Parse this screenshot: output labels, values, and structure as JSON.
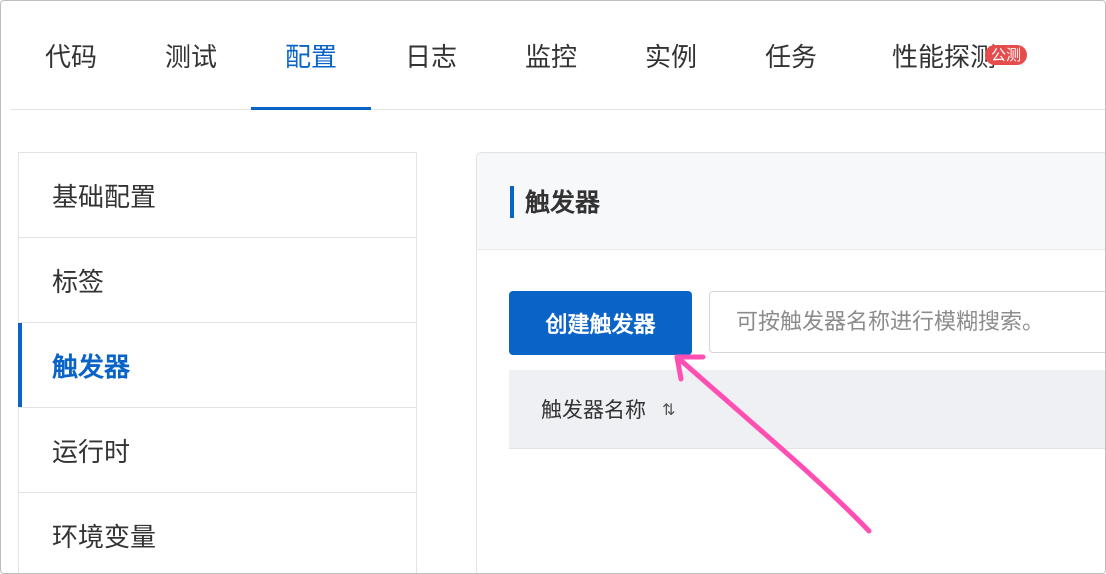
{
  "tabs": [
    "代码",
    "测试",
    "配置",
    "日志",
    "监控",
    "实例",
    "任务",
    "性能探测"
  ],
  "active_tab": "配置",
  "tab_badge": "公测",
  "sidebar": {
    "items": [
      "基础配置",
      "标签",
      "触发器",
      "运行时",
      "环境变量"
    ],
    "active": "触发器"
  },
  "panel": {
    "title": "触发器",
    "create_button": "创建触发器",
    "search_placeholder": "可按触发器名称进行模糊搜索。",
    "table": {
      "columns": [
        "触发器名称"
      ]
    }
  },
  "colors": {
    "accent": "#0a64c8",
    "badge": "#e74c4c",
    "annotation_arrow": "#ff4fb3"
  },
  "icons": {
    "sort": "sort-arrows-icon"
  }
}
